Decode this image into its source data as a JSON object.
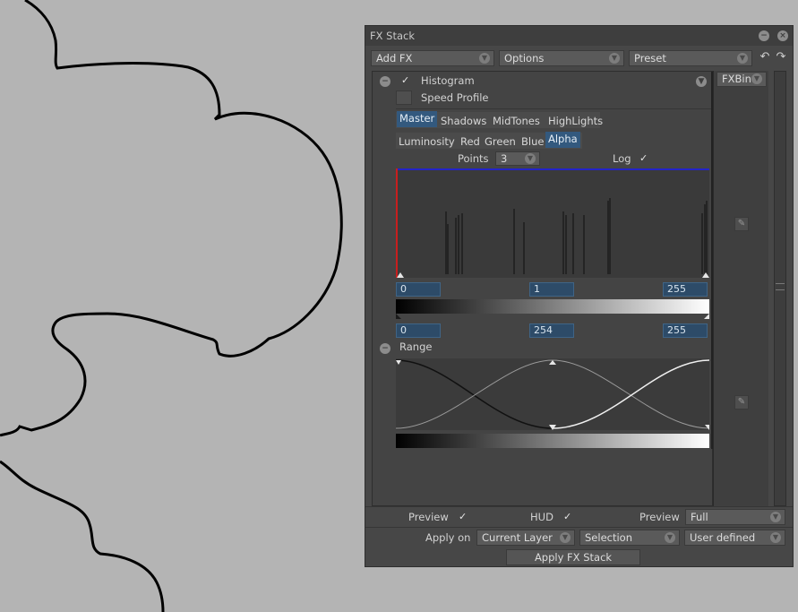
{
  "window": {
    "title": "FX Stack"
  },
  "toolbar": {
    "add_fx": "Add FX",
    "options": "Options",
    "preset": "Preset"
  },
  "fxbin": {
    "label": "FXBin"
  },
  "histogram": {
    "title": "Histogram",
    "enabled_check": "✓",
    "speed_profile_label": "Speed Profile",
    "tonal_tabs": [
      {
        "label": "Master",
        "selected": true
      },
      {
        "label": "Shadows",
        "selected": false
      },
      {
        "label": "MidTones",
        "selected": false
      },
      {
        "label": "HighLights",
        "selected": false
      }
    ],
    "channel_tabs": [
      {
        "label": "Luminosity",
        "selected": false
      },
      {
        "label": "Red",
        "selected": false
      },
      {
        "label": "Green",
        "selected": false
      },
      {
        "label": "Blue",
        "selected": false
      },
      {
        "label": "Alpha",
        "selected": true
      }
    ],
    "points_label": "Points",
    "points_value": "3",
    "log_label": "Log",
    "log_check": "✓",
    "input_fields": [
      "0",
      "1",
      "255"
    ],
    "output_fields": [
      "0",
      "254",
      "255"
    ]
  },
  "range": {
    "title": "Range"
  },
  "bottom": {
    "preview_label": "Preview",
    "preview_check": "✓",
    "hud_label": "HUD",
    "hud_check": "✓",
    "preview2_label": "Preview",
    "preview_mode": "Full",
    "apply_on_label": "Apply on",
    "apply_target": "Current Layer",
    "apply_selection": "Selection",
    "apply_mode": "User defined",
    "apply_button": "Apply FX Stack"
  },
  "colors": {
    "window_bg": "#474747",
    "selected_tab": "#33597e",
    "field_bg": "#2d4b68",
    "canvas_bg": "#b4b4b4"
  },
  "icons": {
    "collapse": "minus-circle-icon",
    "close": "close-icon",
    "undo": "undo-icon",
    "redo": "redo-icon",
    "tool": "wrench-icon"
  }
}
